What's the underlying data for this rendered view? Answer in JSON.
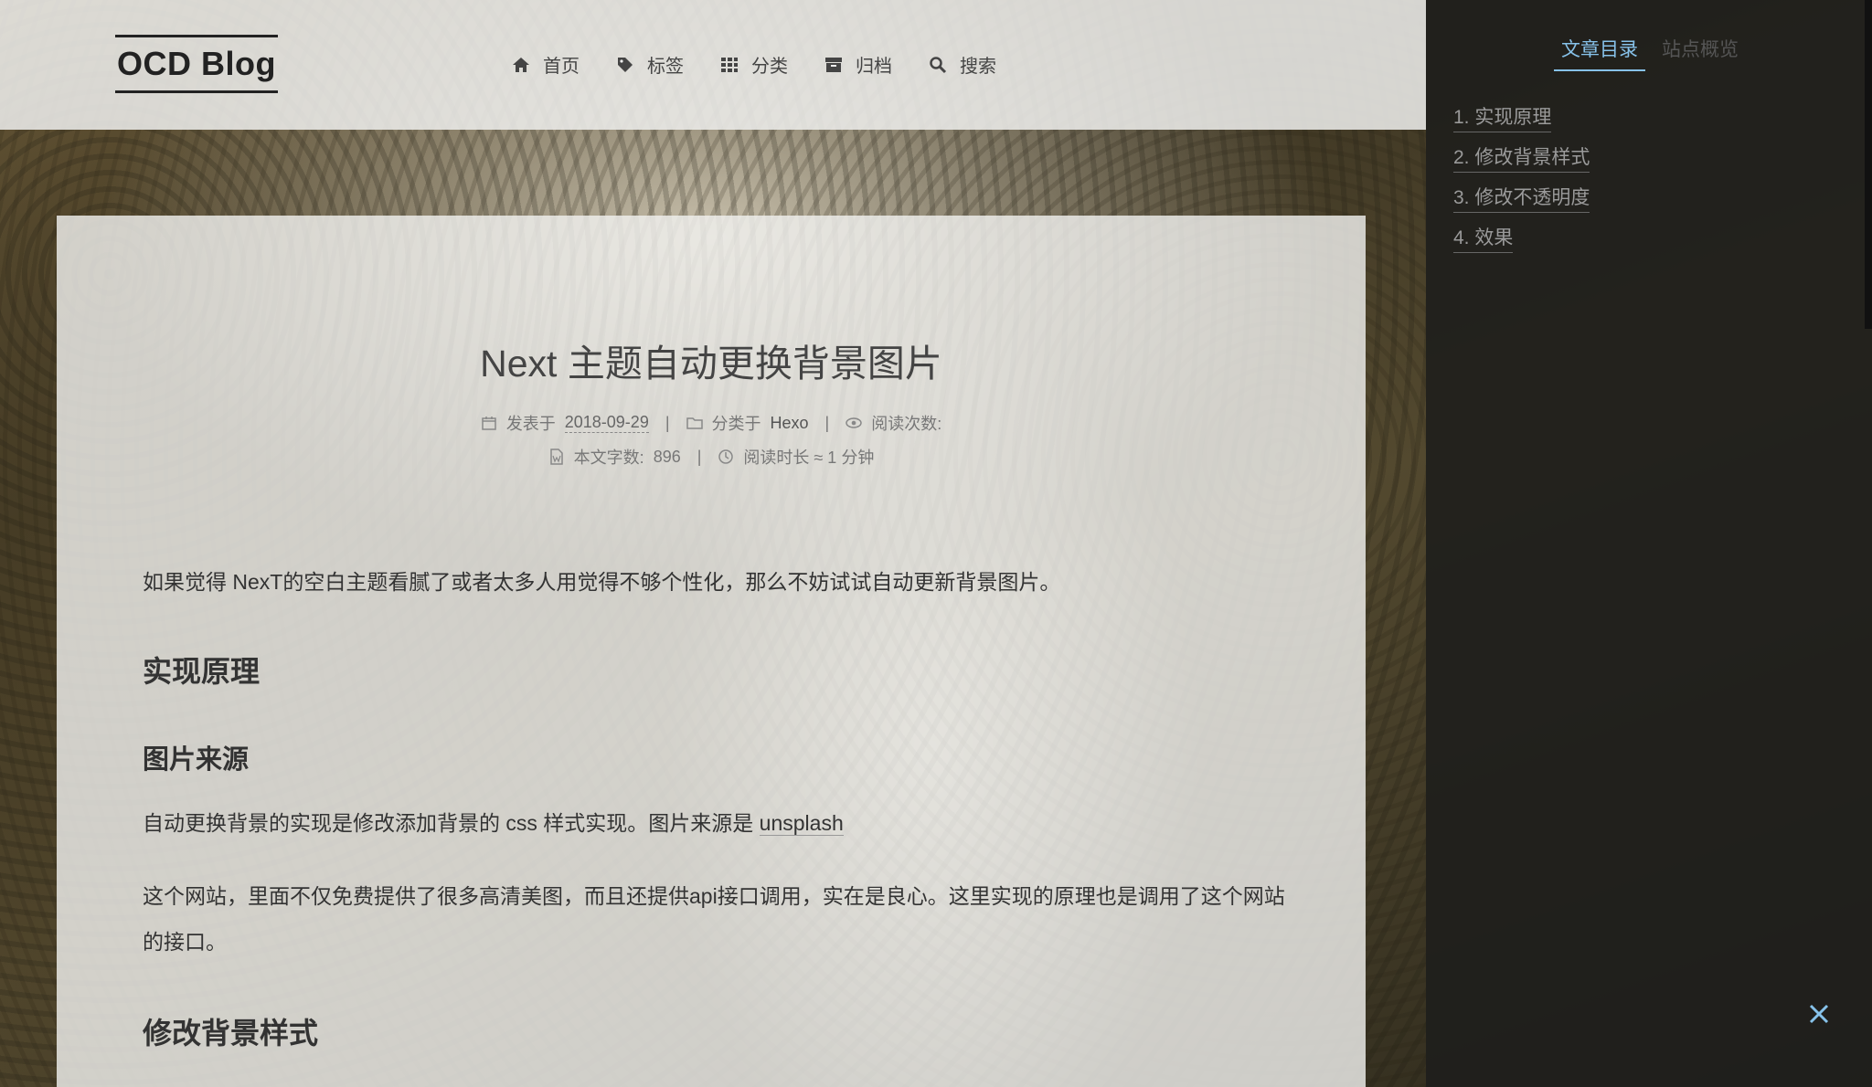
{
  "header": {
    "brand": "OCD Blog",
    "menu": [
      {
        "label": "首页",
        "icon": "home-icon"
      },
      {
        "label": "标签",
        "icon": "tags-icon"
      },
      {
        "label": "分类",
        "icon": "grid-icon"
      },
      {
        "label": "归档",
        "icon": "archive-icon"
      },
      {
        "label": "搜索",
        "icon": "search-icon"
      }
    ]
  },
  "post": {
    "title": "Next 主题自动更换背景图片",
    "meta": {
      "posted_label": "发表于",
      "date": "2018-09-29",
      "category_label": "分类于",
      "category": "Hexo",
      "views_label": "阅读次数:",
      "wordcount_label": "本文字数:",
      "wordcount": "896",
      "readtime": "阅读时长 ≈ 1 分钟"
    },
    "intro": "如果觉得 NexT的空白主题看腻了或者太多人用觉得不够个性化，那么不妨试试自动更新背景图片。",
    "h_principle": "实现原理",
    "h_source": "图片来源",
    "p_source_prefix": "自动更换背景的实现是修改添加背景的 css 样式实现。图片来源是 ",
    "p_source_link": "unsplash",
    "p_site": "这个网站，里面不仅免费提供了很多高清美图，而且还提供api接口调用，实在是良心。这里实现的原理也是调用了这个网站的接口。",
    "h_modify": "修改背景样式"
  },
  "sidebar": {
    "tabs": [
      "文章目录",
      "站点概览"
    ],
    "toc": [
      "1. 实现原理",
      "2. 修改背景样式",
      "3. 修改不透明度",
      "4. 效果"
    ],
    "accent": "#87c2ea"
  }
}
